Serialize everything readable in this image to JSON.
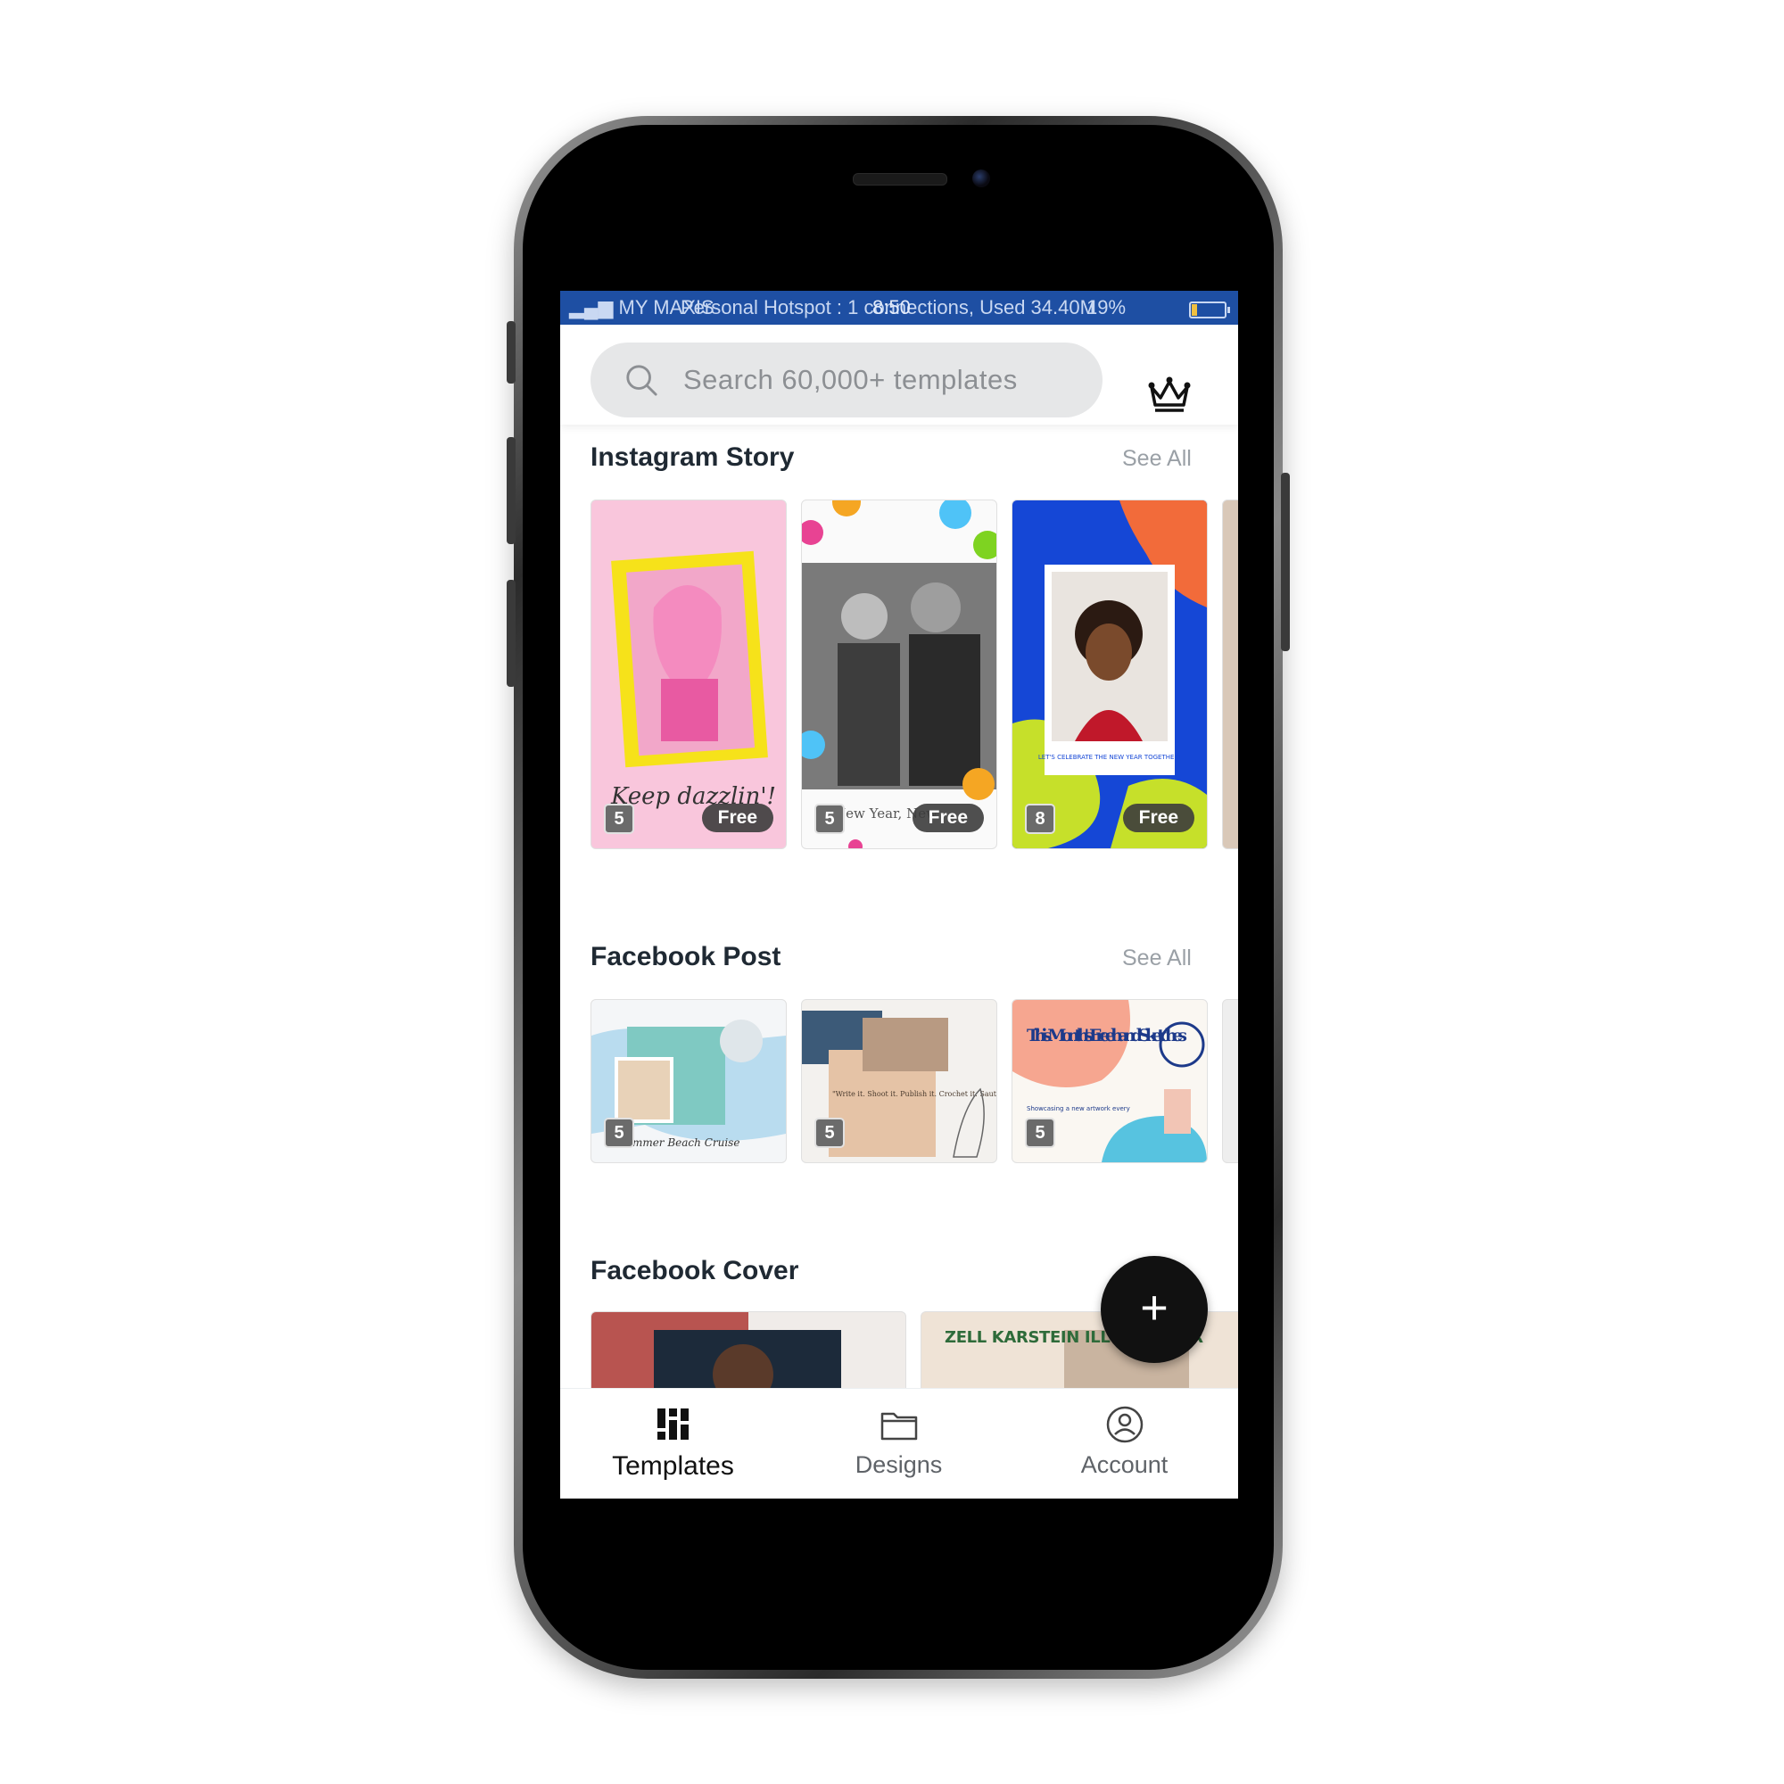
{
  "status_bar": {
    "carrier": "MY MAXIS",
    "hotspot_text": "Personal Hotspot : 1 connections, Used 34.40M",
    "time": "8:50",
    "battery": "19%",
    "battery_level": 0.19
  },
  "search": {
    "placeholder": "Search 60,000+ templates",
    "icon": "search-icon"
  },
  "header": {
    "premium_icon": "crown-icon"
  },
  "sections": [
    {
      "title": "Instagram Story",
      "see_all": "See All",
      "cards": [
        {
          "count": "5",
          "badge": "Free",
          "caption": "Keep dazzlin'!"
        },
        {
          "count": "5",
          "badge": "Free",
          "caption": "New Year, New"
        },
        {
          "count": "8",
          "badge": "Free",
          "caption": "LET'S CELEBRATE THE NEW YEAR TOGETHER!"
        }
      ]
    },
    {
      "title": "Facebook Post",
      "see_all": "See All",
      "cards": [
        {
          "count": "5",
          "caption": "Summer Beach Cruise"
        },
        {
          "count": "5",
          "caption": "\"Write it. Shoot it. Publish it. Crochet it. Sauté it, whatever. Make.\""
        },
        {
          "count": "5",
          "caption": "This Month's Freehand Sketches",
          "subcaption": "Showcasing a new artwork every"
        }
      ]
    },
    {
      "title": "Facebook Cover",
      "cards": [
        {
          "caption": ""
        },
        {
          "caption": "ZELL KARSTEIN ILLUSTRATOR"
        }
      ]
    }
  ],
  "fab": {
    "label": "+"
  },
  "bottom_nav": [
    {
      "label": "Templates",
      "icon": "templates-grid-icon",
      "active": true
    },
    {
      "label": "Designs",
      "icon": "folder-icon",
      "active": false
    },
    {
      "label": "Account",
      "icon": "account-circle-icon",
      "active": false
    }
  ],
  "colors": {
    "status_bar": "#1e4fa3",
    "fab": "#111111",
    "badge": "#3c3c3c"
  }
}
